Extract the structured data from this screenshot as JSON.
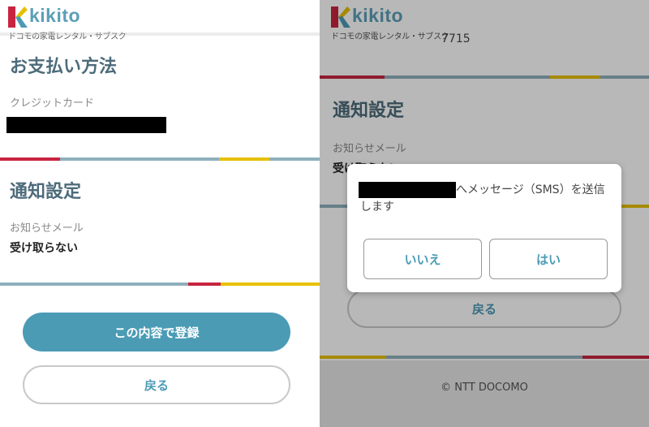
{
  "brand": {
    "name": "kikito",
    "tagline": "ドコモの家電レンタル・サブスク",
    "colors": {
      "accent": "#4b9bb5",
      "red": "#c8243f",
      "yellow": "#e6c000",
      "blue_gray": "#8fb0bd"
    }
  },
  "left": {
    "payment": {
      "heading": "お支払い方法",
      "card_label": "クレジットカード"
    },
    "notifications": {
      "heading": "通知設定",
      "email_label": "お知らせメール",
      "email_value": "受け取らない"
    },
    "actions": {
      "submit_label": "この内容で登録",
      "back_label": "戻る"
    }
  },
  "right": {
    "partial_number": "7715",
    "notifications": {
      "heading": "通知設定",
      "email_label": "お知らせメール",
      "email_value": "受け取らない"
    },
    "back_label": "戻る",
    "footer": "© NTT DOCOMO",
    "dialog": {
      "message": "へメッセージ（SMS）を送信します",
      "no_label": "いいえ",
      "yes_label": "はい"
    }
  }
}
